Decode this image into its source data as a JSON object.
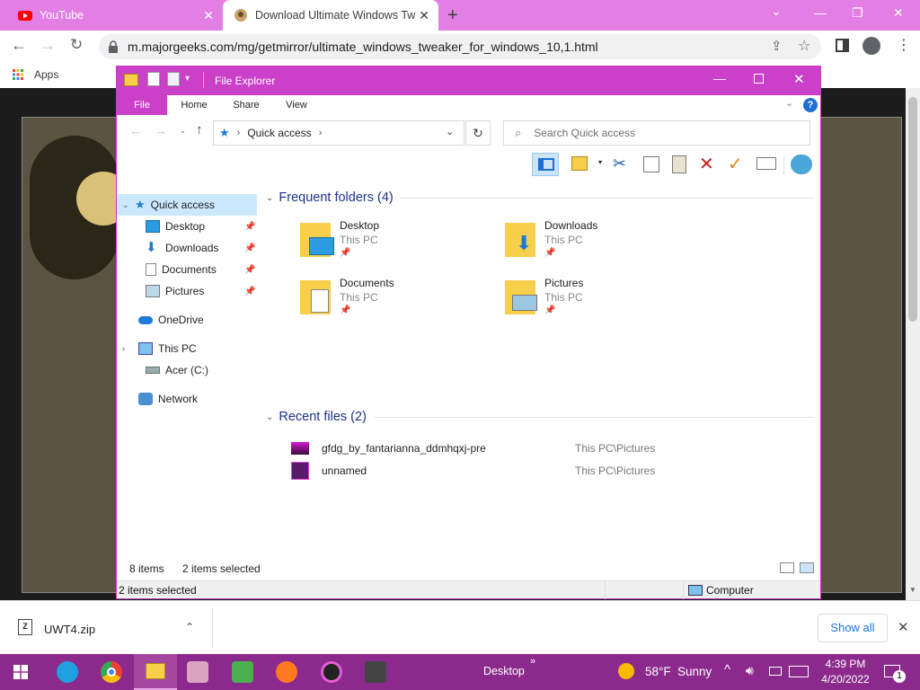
{
  "browser": {
    "tabs": [
      {
        "label": "YouTube"
      },
      {
        "label": "Download Ultimate Windows Tw"
      }
    ],
    "url": "m.majorgeeks.com/mg/getmirror/ultimate_windows_tweaker_for_windows_10,1.html",
    "bookmarks": {
      "apps_label": "Apps"
    },
    "new_tab_symbol": "+"
  },
  "explorer": {
    "title": "File Explorer",
    "ribbon_tabs": [
      "File",
      "Home",
      "Share",
      "View"
    ],
    "address": "Quick access",
    "search_placeholder": "Search Quick access",
    "nav": {
      "quick_access": "Quick access",
      "desktop": "Desktop",
      "downloads": "Downloads",
      "documents": "Documents",
      "pictures": "Pictures",
      "onedrive": "OneDrive",
      "this_pc": "This PC",
      "acer": "Acer (C:)",
      "network": "Network"
    },
    "frequent": {
      "header": "Frequent folders (4)",
      "folders": [
        {
          "name": "Desktop",
          "loc": "This PC"
        },
        {
          "name": "Downloads",
          "loc": "This PC"
        },
        {
          "name": "Documents",
          "loc": "This PC"
        },
        {
          "name": "Pictures",
          "loc": "This PC"
        }
      ]
    },
    "recent": {
      "header": "Recent files (2)",
      "files": [
        {
          "name": "gfdg_by_fantarianna_ddmhqxj-pre",
          "path": "This PC\\Pictures"
        },
        {
          "name": "unnamed",
          "path": "This PC\\Pictures"
        }
      ]
    },
    "status": {
      "items": "8 items",
      "selected": "2 items selected",
      "bottom_selected": "2 items selected",
      "computer": "Computer"
    },
    "accent_color": "#ca40c9"
  },
  "download_bar": {
    "file": "UWT4.zip",
    "show_all": "Show all"
  },
  "taskbar": {
    "desktop_label": "Desktop",
    "chevron": "»",
    "weather_temp": "58°F",
    "weather_desc": "Sunny",
    "time": "4:39 PM",
    "date": "4/20/2022",
    "notification_count": "1",
    "color": "#8b2a8c"
  }
}
